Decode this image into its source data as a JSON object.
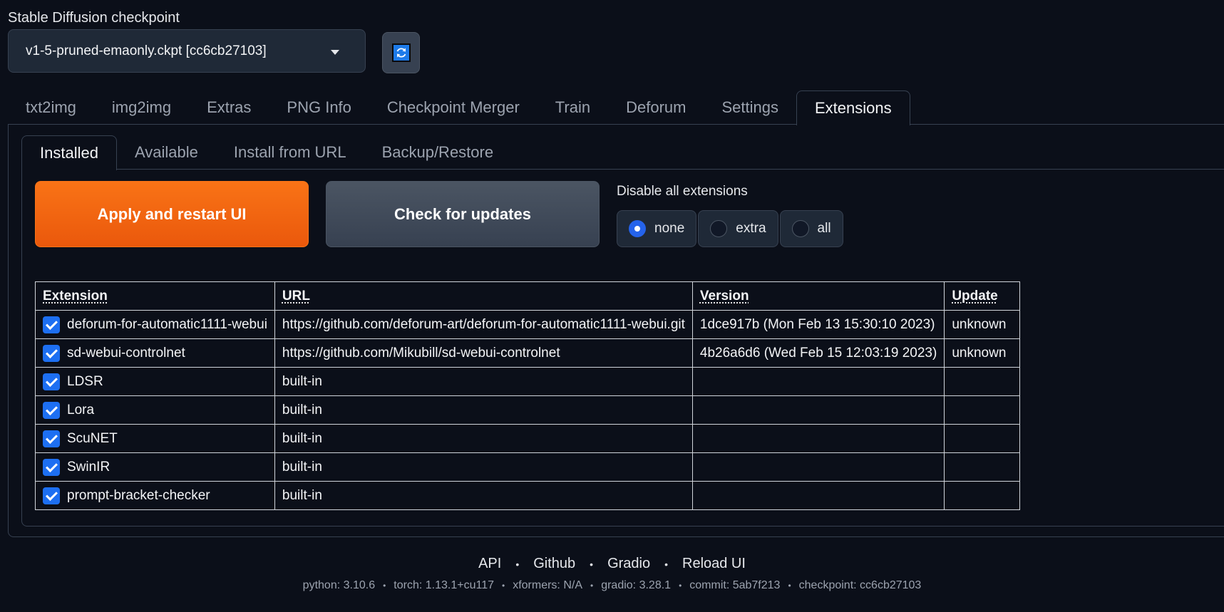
{
  "checkpoint": {
    "label": "Stable Diffusion checkpoint",
    "selected": "v1-5-pruned-emaonly.ckpt [cc6cb27103]"
  },
  "main_tabs": [
    "txt2img",
    "img2img",
    "Extras",
    "PNG Info",
    "Checkpoint Merger",
    "Train",
    "Deforum",
    "Settings",
    "Extensions"
  ],
  "main_tab_active": "Extensions",
  "sub_tabs": [
    "Installed",
    "Available",
    "Install from URL",
    "Backup/Restore"
  ],
  "sub_tab_active": "Installed",
  "buttons": {
    "apply": "Apply and restart UI",
    "check": "Check for updates"
  },
  "disable": {
    "label": "Disable all extensions",
    "options": [
      "none",
      "extra",
      "all"
    ],
    "selected": "none"
  },
  "table": {
    "headers": [
      "Extension",
      "URL",
      "Version",
      "Update"
    ],
    "rows": [
      {
        "name": "deforum-for-automatic1111-webui",
        "url": "https://github.com/deforum-art/deforum-for-automatic1111-webui.git",
        "version": "1dce917b (Mon Feb 13 15:30:10 2023)",
        "update": "unknown",
        "checked": true
      },
      {
        "name": "sd-webui-controlnet",
        "url": "https://github.com/Mikubill/sd-webui-controlnet",
        "version": "4b26a6d6 (Wed Feb 15 12:03:19 2023)",
        "update": "unknown",
        "checked": true
      },
      {
        "name": "LDSR",
        "url": "built-in",
        "version": "",
        "update": "",
        "checked": true
      },
      {
        "name": "Lora",
        "url": "built-in",
        "version": "",
        "update": "",
        "checked": true
      },
      {
        "name": "ScuNET",
        "url": "built-in",
        "version": "",
        "update": "",
        "checked": true
      },
      {
        "name": "SwinIR",
        "url": "built-in",
        "version": "",
        "update": "",
        "checked": true
      },
      {
        "name": "prompt-bracket-checker",
        "url": "built-in",
        "version": "",
        "update": "",
        "checked": true
      }
    ]
  },
  "footer": {
    "links": [
      "API",
      "Github",
      "Gradio",
      "Reload UI"
    ],
    "info": [
      "python: 3.10.6",
      "torch: 1.13.1+cu117",
      "xformers: N/A",
      "gradio: 3.28.1",
      "commit: 5ab7f213",
      "checkpoint: cc6cb27103"
    ]
  },
  "icons": {
    "refresh": "refresh-icon",
    "dropdown": "chevron-down-icon",
    "checkbox": "checkbox-checked-icon"
  },
  "colors": {
    "background": "#0b0f19",
    "primary_button": "#f97316",
    "secondary_button": "#4b5563",
    "checkbox": "#1d6ff2",
    "radio_selected": "#2563eb"
  }
}
